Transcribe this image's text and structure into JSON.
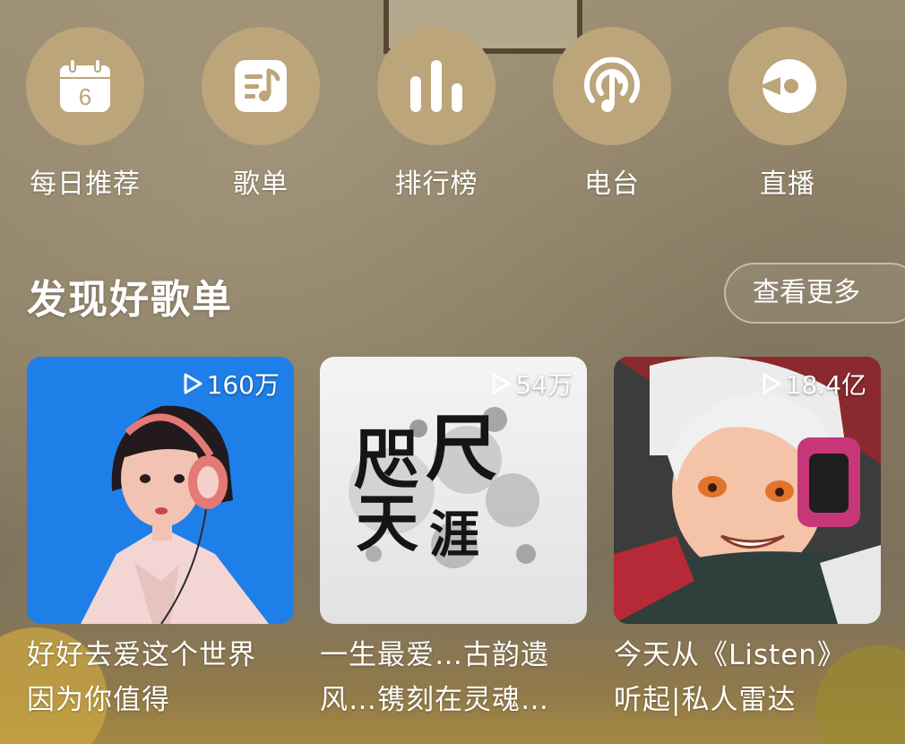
{
  "nav": [
    {
      "label": "每日推荐",
      "icon": "calendar-icon",
      "day": "6"
    },
    {
      "label": "歌单",
      "icon": "playlist-icon"
    },
    {
      "label": "排行榜",
      "icon": "chart-bars-icon"
    },
    {
      "label": "电台",
      "icon": "radio-podcast-icon"
    },
    {
      "label": "直播",
      "icon": "live-icon"
    }
  ],
  "section": {
    "title": "发现好歌单",
    "more_label": "查看更多"
  },
  "playlists": [
    {
      "play_count": "160万",
      "title_line1": "好好去爱这个世界",
      "title_line2": "因为你值得",
      "cover": "girl-with-headphones-illustration"
    },
    {
      "play_count": "54万",
      "title_line1": "一生最爱…古韵遗",
      "title_line2": "风…镌刻在灵魂…",
      "cover": "calligraphy-ink",
      "cover_text_1": "咫",
      "cover_text_2": "尺",
      "cover_text_3": "天",
      "cover_text_4": "涯"
    },
    {
      "play_count": "18.4亿",
      "title_line1": "今天从《Listen》",
      "title_line2": "听起|私人雷达",
      "cover": "anime-character-illustration"
    }
  ],
  "colors": {
    "nav_circle": "#bca57a",
    "text": "#ffffff"
  }
}
